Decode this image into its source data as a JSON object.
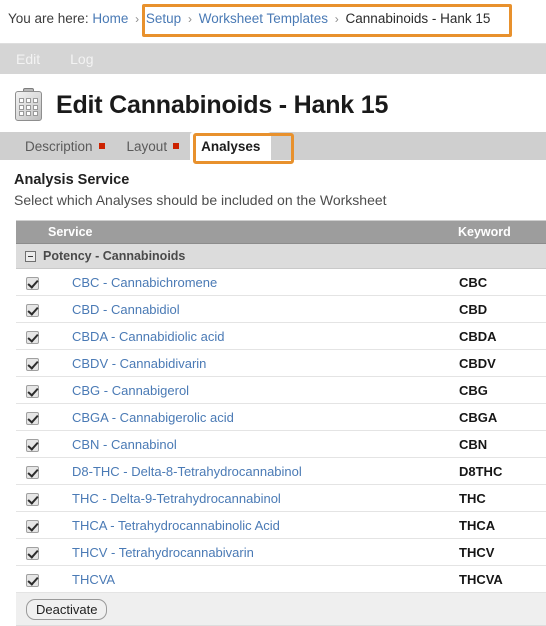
{
  "breadcrumb": {
    "prefix": "You are here:",
    "home_label": "Home",
    "separator": "›",
    "items": [
      {
        "label": "Setup",
        "is_link": true
      },
      {
        "label": "Worksheet Templates",
        "is_link": true
      },
      {
        "label": "Cannabinoids - Hank 15",
        "is_link": false
      }
    ],
    "highlight_color": "#e8912d"
  },
  "toolbar": {
    "items": [
      {
        "label": "Edit"
      },
      {
        "label": "Log"
      }
    ]
  },
  "header": {
    "icon": "worksheet-clipboard-icon",
    "title": "Edit Cannabinoids - Hank 15"
  },
  "subtabs": {
    "items": [
      {
        "label": "Description",
        "active": false,
        "required_marker": true
      },
      {
        "label": "Layout",
        "active": false,
        "required_marker": true
      },
      {
        "label": "Analyses",
        "active": true,
        "required_marker": false
      }
    ],
    "required_marker_color": "#cc2200",
    "highlight_color": "#e8912d"
  },
  "section": {
    "title": "Analysis Service",
    "description": "Select which Analyses should be included on the Worksheet"
  },
  "table": {
    "columns": {
      "select": "",
      "service": "Service",
      "keyword": "Keyword"
    },
    "category": {
      "label": "Potency - Cannabinoids",
      "collapse_icon": "collapse-minus-icon",
      "expanded": true
    },
    "rows": [
      {
        "checked": true,
        "service": "CBC - Cannabichromene",
        "keyword": "CBC"
      },
      {
        "checked": true,
        "service": "CBD - Cannabidiol",
        "keyword": "CBD"
      },
      {
        "checked": true,
        "service": "CBDA - Cannabidiolic acid",
        "keyword": "CBDA"
      },
      {
        "checked": true,
        "service": "CBDV - Cannabidivarin",
        "keyword": "CBDV"
      },
      {
        "checked": true,
        "service": "CBG - Cannabigerol",
        "keyword": "CBG"
      },
      {
        "checked": true,
        "service": "CBGA - Cannabigerolic acid",
        "keyword": "CBGA"
      },
      {
        "checked": true,
        "service": "CBN - Cannabinol",
        "keyword": "CBN"
      },
      {
        "checked": true,
        "service": "D8-THC - Delta-8-Tetrahydrocannabinol",
        "keyword": "D8THC"
      },
      {
        "checked": true,
        "service": "THC - Delta-9-Tetrahydrocannabinol",
        "keyword": "THC"
      },
      {
        "checked": true,
        "service": "THCA - Tetrahydrocannabinolic Acid",
        "keyword": "THCA"
      },
      {
        "checked": true,
        "service": "THCV - Tetrahydrocannabivarin",
        "keyword": "THCV"
      },
      {
        "checked": true,
        "service": "THCVA",
        "keyword": "THCVA"
      }
    ],
    "footer": {
      "deactivate_label": "Deactivate"
    }
  }
}
